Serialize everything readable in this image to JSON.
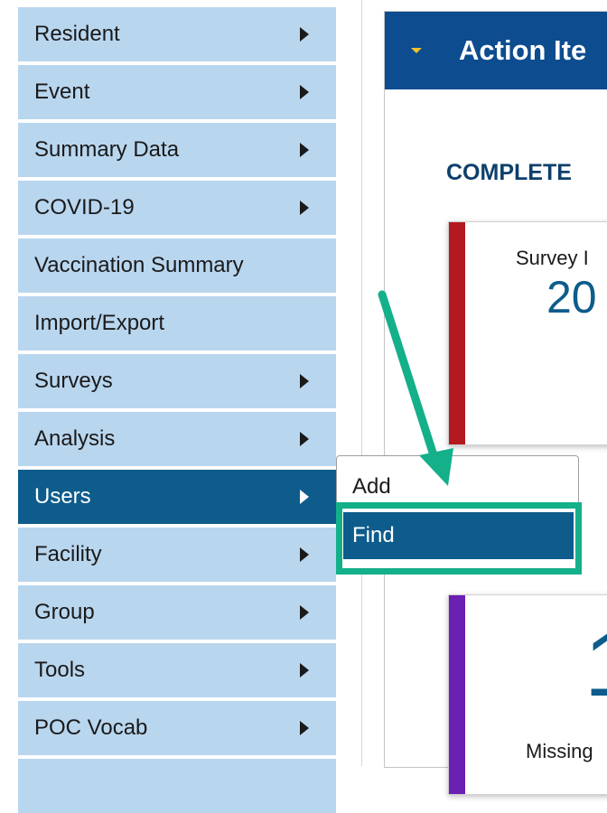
{
  "sidebar": {
    "items": [
      {
        "label": "Resident",
        "has_submenu": true,
        "active": false
      },
      {
        "label": "Event",
        "has_submenu": true,
        "active": false
      },
      {
        "label": "Summary Data",
        "has_submenu": true,
        "active": false
      },
      {
        "label": "COVID-19",
        "has_submenu": true,
        "active": false
      },
      {
        "label": "Vaccination Summary",
        "has_submenu": false,
        "active": false
      },
      {
        "label": "Import/Export",
        "has_submenu": false,
        "active": false
      },
      {
        "label": "Surveys",
        "has_submenu": true,
        "active": false
      },
      {
        "label": "Analysis",
        "has_submenu": true,
        "active": false
      },
      {
        "label": "Users",
        "has_submenu": true,
        "active": true
      },
      {
        "label": "Facility",
        "has_submenu": true,
        "active": false
      },
      {
        "label": "Group",
        "has_submenu": true,
        "active": false
      },
      {
        "label": "Tools",
        "has_submenu": true,
        "active": false
      },
      {
        "label": "POC Vocab",
        "has_submenu": true,
        "active": false
      }
    ]
  },
  "submenu": {
    "items": [
      {
        "label": "Add",
        "active": false
      },
      {
        "label": "Find",
        "active": true
      }
    ]
  },
  "panel": {
    "title": "Action Ite",
    "section_title": "COMPLETE",
    "card1": {
      "label": "Survey I",
      "value": "20"
    },
    "card2": {
      "value": "1",
      "label": "Missing"
    }
  },
  "icons": {
    "panel_caret": "caret-down-icon",
    "submenu_arrow": "chevron-right-icon"
  },
  "colors": {
    "sidebar_item_bg": "#b9d6ef",
    "active_bg": "#0d5c8c",
    "header_bg": "#0d4c8f",
    "caret": "#f2c029",
    "annotation": "#14b08a",
    "card1_stripe": "#b4191f",
    "card2_stripe": "#6b1fb3"
  }
}
